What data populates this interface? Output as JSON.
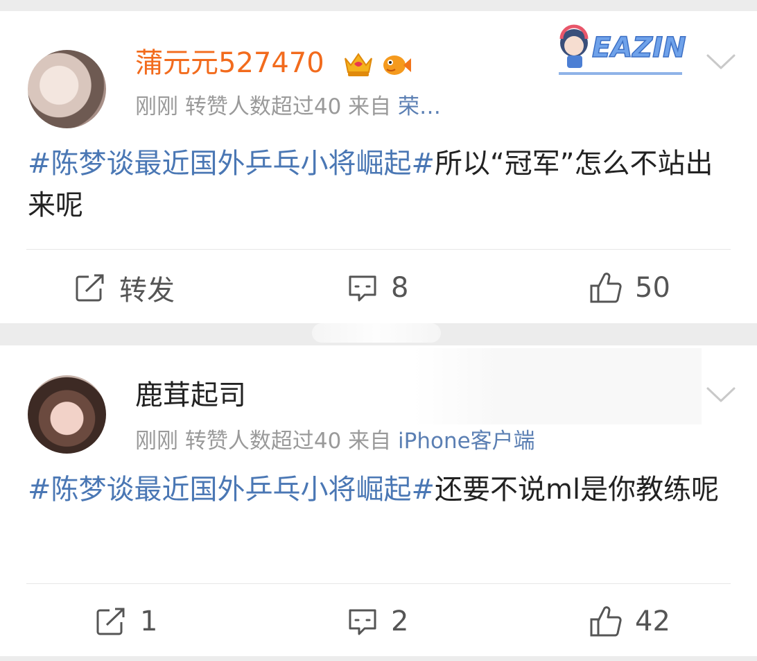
{
  "posts": [
    {
      "username": "蒲元元527470",
      "time": "刚刚",
      "reposts_note": "转赞人数超过40",
      "from_label": "来自",
      "source": "荣…",
      "hashtag": "#陈梦谈最近国外乒乓小将崛起#",
      "text": "所以“冠军”怎么不站出来呢",
      "deco_text": "EAZIN",
      "actions": {
        "repost": "转发",
        "comments": "8",
        "likes": "50"
      }
    },
    {
      "username": "鹿茸起司",
      "time": "刚刚",
      "reposts_note": "转赞人数超过40",
      "from_label": "来自",
      "source": "iPhone客户端",
      "hashtag": "#陈梦谈最近国外乒乓小将崛起#",
      "text": "还要不说ml是你教练呢",
      "actions": {
        "repost": "1",
        "comments": "2",
        "likes": "42"
      }
    }
  ],
  "colors": {
    "accent_orange": "#f26b1d",
    "link_blue": "#4a77b4",
    "source_blue": "#5b7fb3",
    "meta_gray": "#9a9a9a"
  },
  "icons": [
    "chevron-down-icon",
    "repost-icon",
    "comment-icon",
    "like-icon",
    "crown-badge-icon",
    "fish-badge-icon"
  ]
}
